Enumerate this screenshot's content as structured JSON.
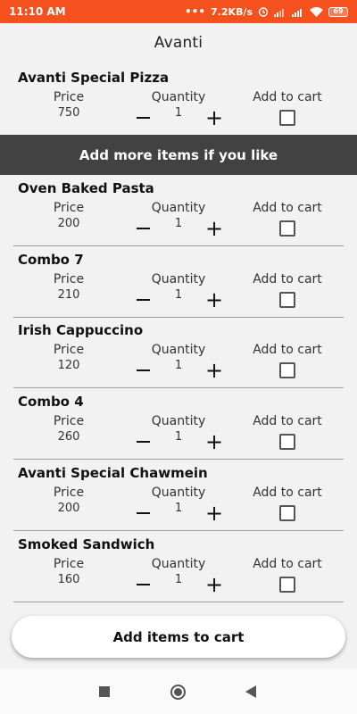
{
  "status_bar": {
    "time": "11:10 AM",
    "net_speed": "7.2KB/s",
    "battery": "69",
    "icons": [
      "alarm-icon",
      "signal-icon",
      "signal-icon",
      "wifi-icon",
      "battery-icon"
    ]
  },
  "app": {
    "title": "Avanti"
  },
  "labels": {
    "price": "Price",
    "quantity": "Quantity",
    "add_to_cart": "Add to cart"
  },
  "featured": {
    "name": "Avanti Special Pizza",
    "price": "750",
    "quantity": "1",
    "checked": false
  },
  "banner": {
    "text": "Add more items if you like"
  },
  "items": [
    {
      "name": "Oven Baked Pasta",
      "price": "200",
      "quantity": "1",
      "checked": false
    },
    {
      "name": "Combo 7",
      "price": "210",
      "quantity": "1",
      "checked": false
    },
    {
      "name": "Irish Cappuccino",
      "price": "120",
      "quantity": "1",
      "checked": false
    },
    {
      "name": "Combo 4",
      "price": "260",
      "quantity": "1",
      "checked": false
    },
    {
      "name": "Avanti Special Chawmein",
      "price": "200",
      "quantity": "1",
      "checked": false
    },
    {
      "name": "Smoked Sandwich",
      "price": "160",
      "quantity": "1",
      "checked": false
    }
  ],
  "actions": {
    "add_items": "Add items to cart"
  },
  "colors": {
    "status_bar": "#f4511e",
    "banner": "#424242",
    "background": "#f2f2f2"
  }
}
